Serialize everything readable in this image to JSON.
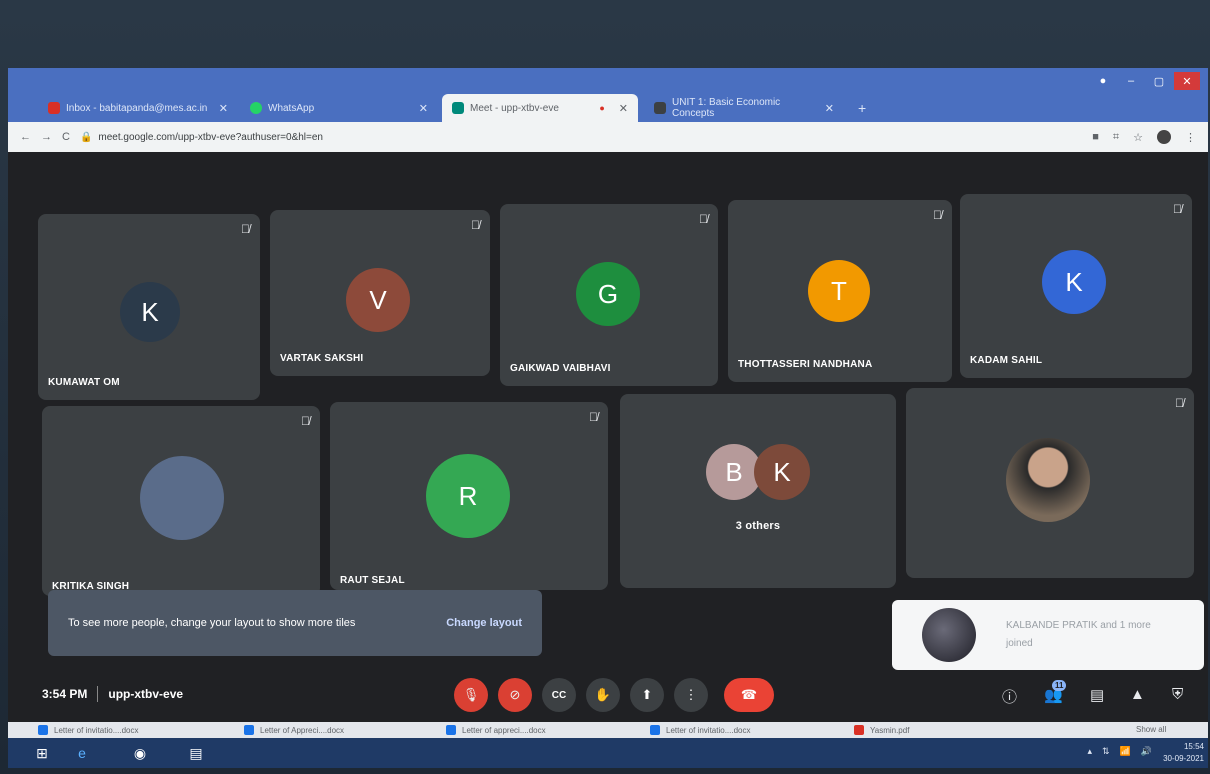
{
  "browser": {
    "tabs": [
      {
        "label": "Inbox - babitapanda@mes.ac.in",
        "color": "#d93025"
      },
      {
        "label": "WhatsApp",
        "color": "#25d366"
      },
      {
        "label": "Meet - upp-xtbv-eve",
        "color": "#00897b"
      },
      {
        "label": "UNIT 1: Basic Economic Concepts",
        "color": "#3c4043"
      }
    ],
    "new_tab": "+",
    "url": "meet.google.com/upp-xtbv-eve?authuser=0&hl=en"
  },
  "participants": [
    {
      "name": "KUMAWAT OM",
      "initial": "K",
      "avatar_color": "#2b3a4a"
    },
    {
      "name": "VARTAK SAKSHI",
      "initial": "V",
      "avatar_color": "#8d4a3a"
    },
    {
      "name": "GAIKWAD VAIBHAVI",
      "initial": "G",
      "avatar_color": "#1e8e3e"
    },
    {
      "name": "THOTTASSERI NANDHANA",
      "initial": "T",
      "avatar_color": "#f29900"
    },
    {
      "name": "KADAM SAHIL",
      "initial": "K",
      "avatar_color": "#3367d6"
    },
    {
      "name": "KRITIKA SINGH",
      "initial": "",
      "avatar_color": "#5a6c8a"
    },
    {
      "name": "RAUT SEJAL",
      "initial": "R",
      "avatar_color": "#34a853"
    },
    {
      "name": "3 others",
      "initial": "",
      "avatar_color": ""
    },
    {
      "name": "",
      "initial": "",
      "avatar_color": "#7a6a5a"
    }
  ],
  "others_avatars": [
    {
      "initial": "B",
      "color": "#b69a9a"
    },
    {
      "initial": "K",
      "color": "#7d4a3a"
    }
  ],
  "notice": {
    "text": "To see more people, change your layout to show more tiles",
    "action": "Change layout"
  },
  "toast": {
    "text": "KALBANDE PRATIK and 1 more joined"
  },
  "meeting": {
    "time": "3:54 PM",
    "code": "upp-xtbv-eve",
    "participant_count": "11"
  },
  "downloads": [
    {
      "label": "Letter of invitatio....docx",
      "type": "doc"
    },
    {
      "label": "Letter of Appreci....docx",
      "type": "doc"
    },
    {
      "label": "Letter of appreci....docx",
      "type": "doc"
    },
    {
      "label": "Letter of invitatio....docx",
      "type": "doc"
    },
    {
      "label": "Yasmin.pdf",
      "type": "pdf"
    }
  ],
  "downloads_show_all": "Show all",
  "taskbar": {
    "time": "15:54",
    "date": "30-09-2021"
  }
}
